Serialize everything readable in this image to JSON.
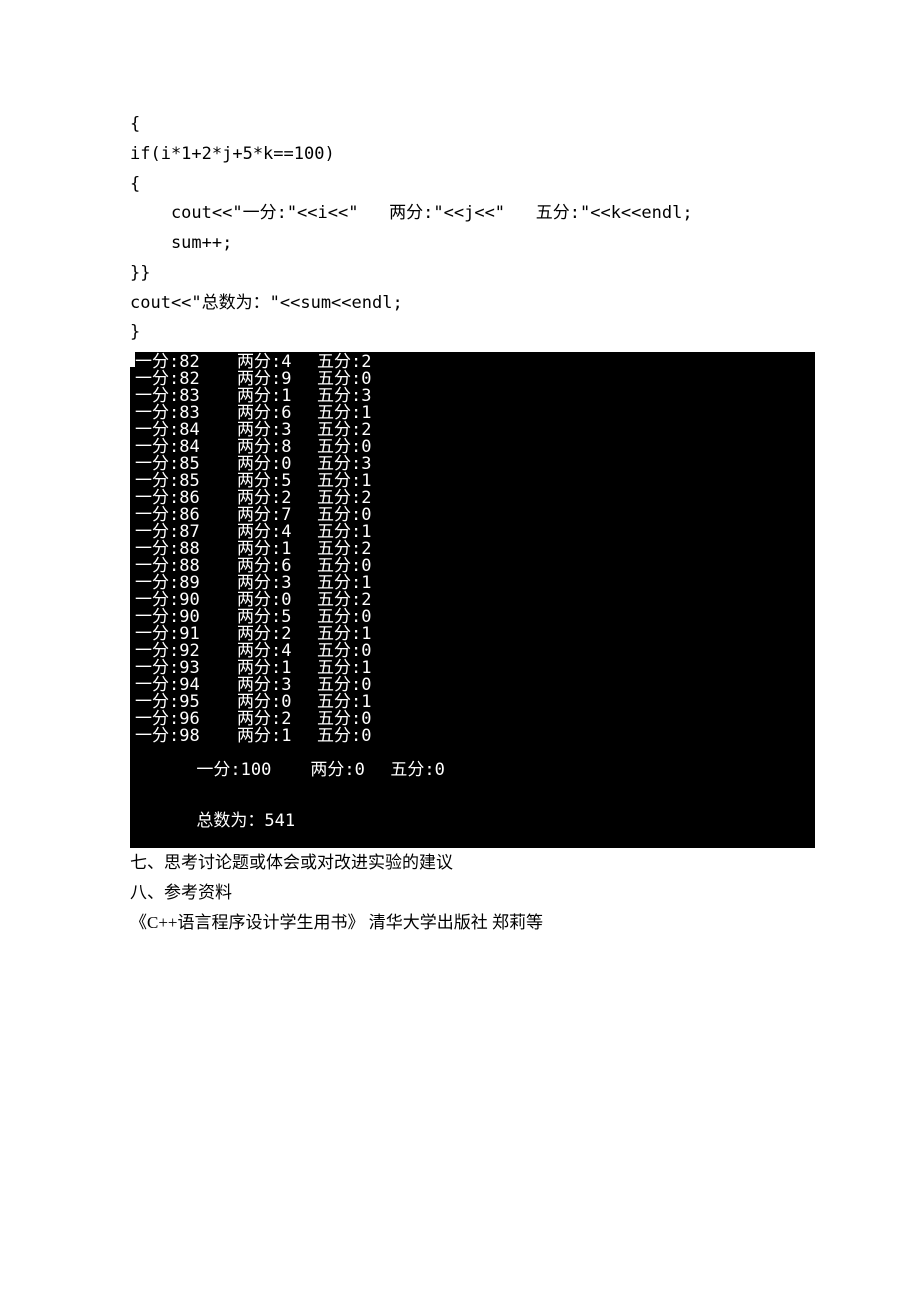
{
  "code": {
    "l1": "{",
    "l2": "if(i*1+2*j+5*k==100)",
    "l3": "{",
    "l4": "    cout<<\"一分:\"<<i<<\"   两分:\"<<j<<\"   五分:\"<<k<<endl;",
    "l5": "    sum++;",
    "l6": "}}",
    "l7": "cout<<\"总数为：\"<<sum<<endl;",
    "l8": "}"
  },
  "terminal": {
    "label1": "一分",
    "label2": "两分",
    "label3": "五分",
    "rows": [
      {
        "a": "82",
        "b": "4",
        "c": "2"
      },
      {
        "a": "82",
        "b": "9",
        "c": "0"
      },
      {
        "a": "83",
        "b": "1",
        "c": "3"
      },
      {
        "a": "83",
        "b": "6",
        "c": "1"
      },
      {
        "a": "84",
        "b": "3",
        "c": "2"
      },
      {
        "a": "84",
        "b": "8",
        "c": "0"
      },
      {
        "a": "85",
        "b": "0",
        "c": "3"
      },
      {
        "a": "85",
        "b": "5",
        "c": "1"
      },
      {
        "a": "86",
        "b": "2",
        "c": "2"
      },
      {
        "a": "86",
        "b": "7",
        "c": "0"
      },
      {
        "a": "87",
        "b": "4",
        "c": "1"
      },
      {
        "a": "88",
        "b": "1",
        "c": "2"
      },
      {
        "a": "88",
        "b": "6",
        "c": "0"
      },
      {
        "a": "89",
        "b": "3",
        "c": "1"
      },
      {
        "a": "90",
        "b": "0",
        "c": "2"
      },
      {
        "a": "90",
        "b": "5",
        "c": "0"
      },
      {
        "a": "91",
        "b": "2",
        "c": "1"
      },
      {
        "a": "92",
        "b": "4",
        "c": "0"
      },
      {
        "a": "93",
        "b": "1",
        "c": "1"
      },
      {
        "a": "94",
        "b": "3",
        "c": "0"
      },
      {
        "a": "95",
        "b": "0",
        "c": "1"
      },
      {
        "a": "96",
        "b": "2",
        "c": "0"
      },
      {
        "a": "98",
        "b": "1",
        "c": "0"
      }
    ],
    "lastRow": {
      "a": "100",
      "b": "0",
      "c": "0"
    },
    "totalLabel": "总数为：",
    "totalValue": "541"
  },
  "footer": {
    "section7": "七、思考讨论题或体会或对改进实验的建议",
    "section8": "八、参考资料",
    "ref": "《C++语言程序设计学生用书》   清华大学出版社   郑莉等"
  }
}
